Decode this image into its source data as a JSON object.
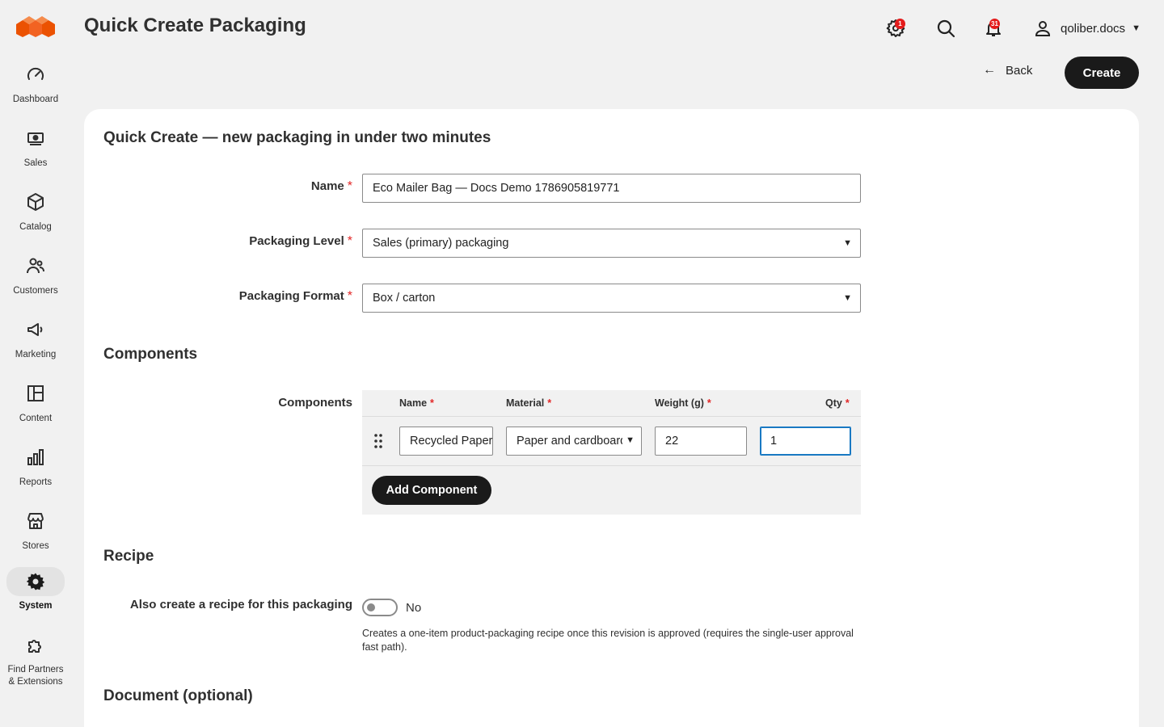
{
  "colors": {
    "accent": "#eb5202",
    "dark": "#1a1a1a",
    "required": "#e22626",
    "focus": "#1979c3"
  },
  "sidebar": {
    "logo": "magento-logo",
    "items": [
      {
        "label": "Dashboard",
        "icon": "gauge-icon"
      },
      {
        "label": "Sales",
        "icon": "cash-icon"
      },
      {
        "label": "Catalog",
        "icon": "cube-icon"
      },
      {
        "label": "Customers",
        "icon": "users-icon"
      },
      {
        "label": "Marketing",
        "icon": "megaphone-icon"
      },
      {
        "label": "Content",
        "icon": "layout-icon"
      },
      {
        "label": "Reports",
        "icon": "bar-chart-icon"
      },
      {
        "label": "Stores",
        "icon": "store-icon"
      },
      {
        "label": "System",
        "icon": "gear-icon",
        "active": true
      },
      {
        "label": "Find Partners & Extensions",
        "icon": "puzzle-icon"
      }
    ]
  },
  "header": {
    "title": "Quick Create Packaging",
    "system_messages_count": "1",
    "notifications_count": "31",
    "username": "qoliber.docs",
    "back_label": "Back",
    "create_label": "Create"
  },
  "form": {
    "title": "Quick Create — new packaging in under two minutes",
    "name_label": "Name",
    "name_value": "Eco Mailer Bag — Docs Demo 1786905819771",
    "level_label": "Packaging Level",
    "level_value": "Sales (primary) packaging",
    "format_label": "Packaging Format",
    "format_value": "Box / carton",
    "required_mark": "*"
  },
  "components": {
    "section_title": "Components",
    "field_label": "Components",
    "columns": {
      "name": "Name",
      "material": "Material",
      "weight": "Weight (g)",
      "qty": "Qty"
    },
    "rows": [
      {
        "name": "Recycled Paper",
        "material": "Paper and cardboard",
        "weight": "22",
        "qty": "1"
      }
    ],
    "add_label": "Add Component"
  },
  "recipe": {
    "section_title": "Recipe",
    "toggle_label": "Also create a recipe for this packaging",
    "toggle_value": "No",
    "toggle_on": false,
    "help": "Creates a one-item product-packaging recipe once this revision is approved (requires the single-user approval fast path)."
  },
  "document": {
    "section_title": "Document (optional)"
  }
}
